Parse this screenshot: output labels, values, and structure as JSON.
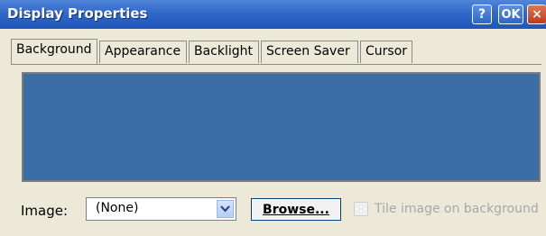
{
  "window": {
    "title": "Display Properties",
    "buttons": {
      "help": "?",
      "ok": "OK",
      "close": "×"
    }
  },
  "tabs": [
    {
      "label": "Background",
      "active": true
    },
    {
      "label": "Appearance",
      "active": false
    },
    {
      "label": "Backlight",
      "active": false
    },
    {
      "label": "Screen Saver",
      "active": false
    },
    {
      "label": "Cursor",
      "active": false
    }
  ],
  "preview": {
    "background_color": "#3a6ea5"
  },
  "image": {
    "label": "Image:",
    "selected_value": "(None)",
    "browse_label": "Browse...",
    "tile_label": "Tile image on background",
    "tile_checked": false,
    "tile_enabled": false
  }
}
